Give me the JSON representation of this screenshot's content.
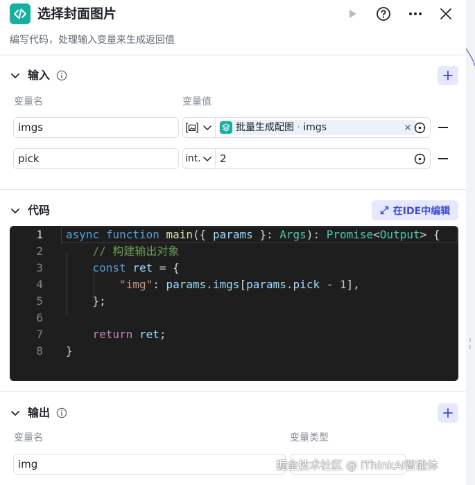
{
  "header": {
    "title": "选择封面图片",
    "description": "编写代码，处理输入变量来生成返回值",
    "icons": [
      "code-node-icon",
      "play-icon",
      "help-icon",
      "more-icon",
      "close-icon"
    ]
  },
  "input": {
    "title": "输入",
    "col_name": "变量名",
    "col_value": "变量值",
    "rows": [
      {
        "name": "imgs",
        "type_icon": "image-array-icon",
        "ref_node": "批量生成配图",
        "ref_sep": " · ",
        "ref_var": "imgs"
      },
      {
        "name": "pick",
        "type_label": "int.",
        "value": "2"
      }
    ]
  },
  "code": {
    "title": "代码",
    "ide_button": "在IDE中编辑",
    "line_numbers": [
      "1",
      "2",
      "3",
      "4",
      "5",
      "6",
      "7",
      "8"
    ],
    "tokens": {
      "l1": [
        "async",
        " ",
        "function",
        " ",
        "main",
        "({ ",
        "params",
        " }: ",
        "Args",
        "): ",
        "Promise",
        "<",
        "Output",
        "> {"
      ],
      "l2": [
        "    ",
        "// 构建输出对象"
      ],
      "l3": [
        "    ",
        "const",
        " ",
        "ret",
        " = {"
      ],
      "l4": [
        "        ",
        "\"img\"",
        ": ",
        "params",
        ".",
        "imgs",
        "[",
        "params",
        ".",
        "pick",
        " - ",
        "1",
        "],"
      ],
      "l5": [
        "    ",
        "};"
      ],
      "l6": [
        ""
      ],
      "l7": [
        "    ",
        "return",
        " ",
        "ret",
        ";"
      ],
      "l8": [
        "}"
      ]
    }
  },
  "output": {
    "title": "输出",
    "col_name": "变量名",
    "col_type": "变量类型",
    "rows": [
      {
        "name": "img"
      }
    ]
  },
  "watermark": "掘金技术社区 @ iThinkAI智能体",
  "colors": {
    "accent": "#3c4bd6",
    "accent_bg": "#e6e8ff",
    "node_icon": "#16b0a0",
    "editor_bg": "#1e1e1e"
  }
}
